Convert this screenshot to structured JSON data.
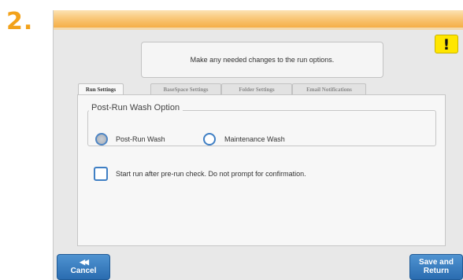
{
  "step_number": "2.",
  "warning": {
    "icon": "exclamation-icon",
    "symbol": "!"
  },
  "message": "Make any needed changes to the run options.",
  "tabs": [
    {
      "label": "Run Settings",
      "active": true
    },
    {
      "label": "BaseSpace Settings",
      "active": false
    },
    {
      "label": "Folder Settings",
      "active": false
    },
    {
      "label": "Email Notifications",
      "active": false
    }
  ],
  "wash": {
    "legend": "Post-Run Wash Option",
    "options": [
      {
        "label": "Post-Run Wash",
        "selected": true
      },
      {
        "label": "Maintenance Wash",
        "selected": false
      }
    ]
  },
  "start_check": {
    "label": "Start run after pre-run check. Do not prompt for confirmation.",
    "checked": false
  },
  "buttons": {
    "cancel": {
      "icon": "rewind-icon",
      "glyph": "◀◀",
      "label": "Cancel"
    },
    "save": {
      "label_line1": "Save and",
      "label_line2": "Return"
    }
  },
  "colors": {
    "accent": "#f5ae47",
    "step": "#f2a21b",
    "button": "#2a6cb0",
    "warning": "#ffe600"
  }
}
